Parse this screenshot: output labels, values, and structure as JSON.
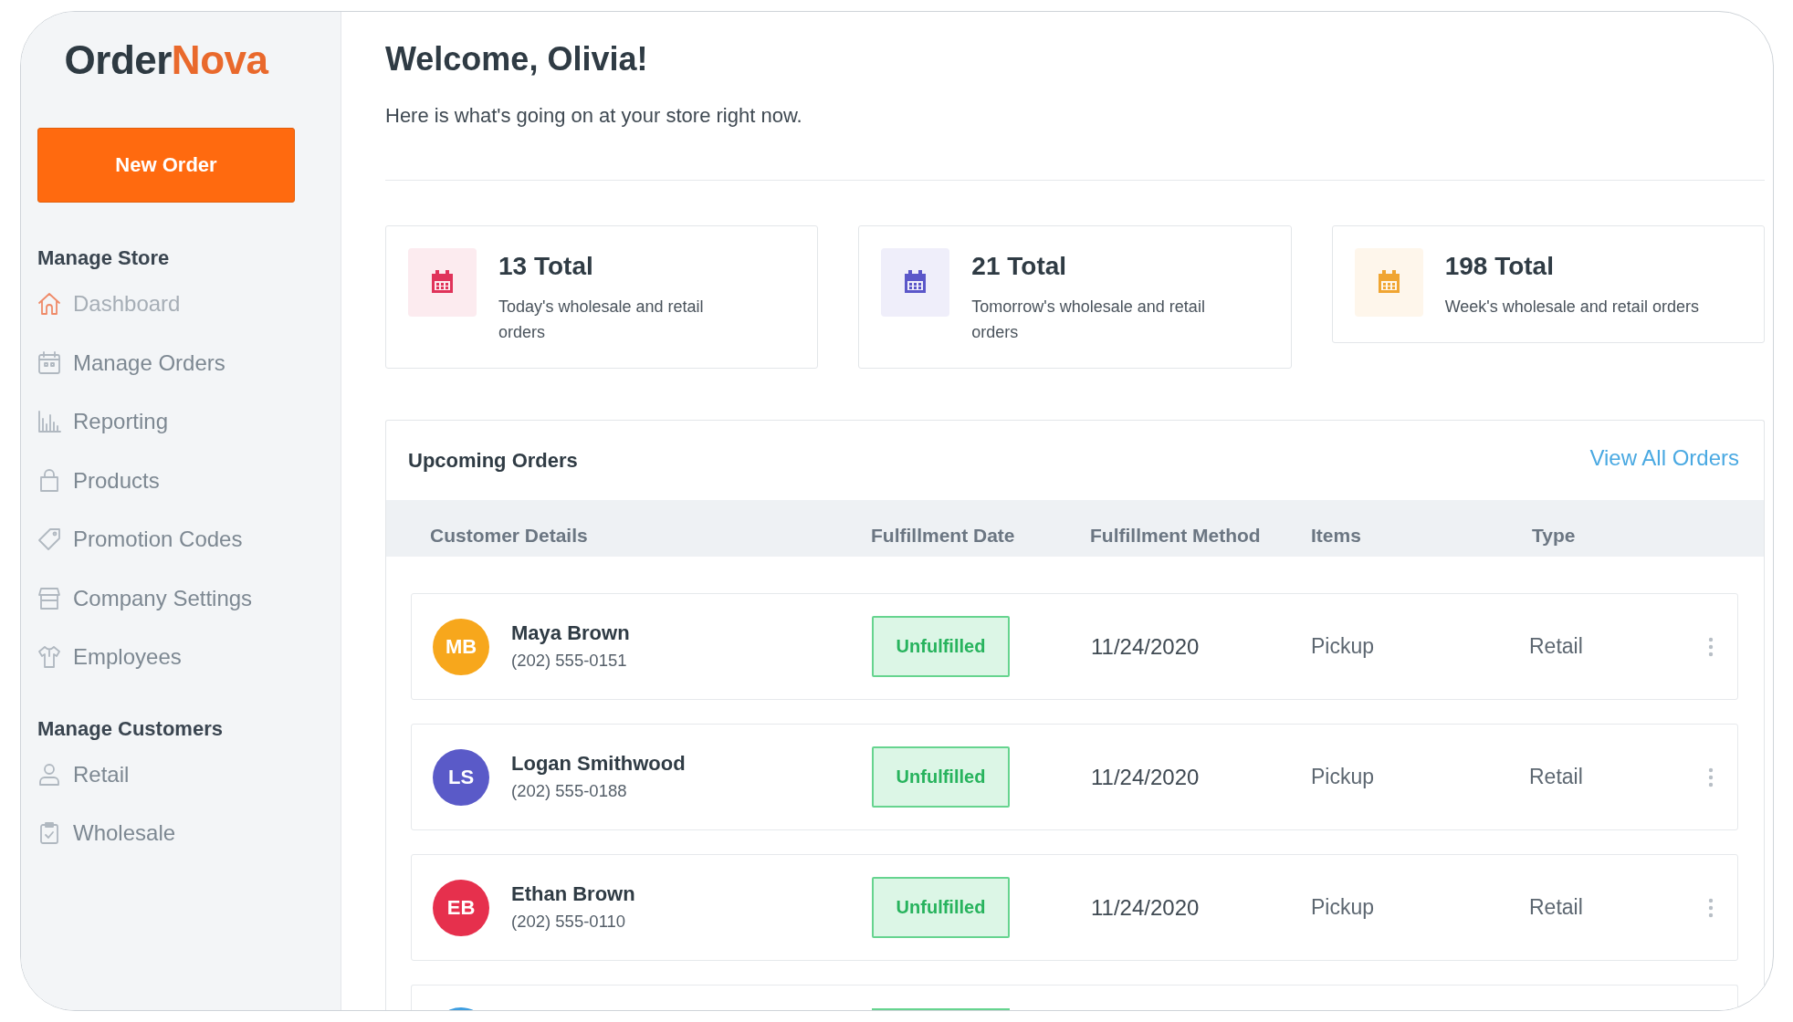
{
  "logo": {
    "primary": "Order",
    "accent": "Nova"
  },
  "sidebar": {
    "button": "New Order",
    "sections": [
      {
        "title": "Manage Store",
        "items": [
          {
            "label": "Dashboard",
            "selected": true
          },
          {
            "label": "Manage Orders",
            "selected": false
          },
          {
            "label": "Reporting",
            "selected": false
          },
          {
            "label": "Products",
            "selected": false
          },
          {
            "label": "Promotion Codes",
            "selected": false
          },
          {
            "label": "Company Settings",
            "selected": false
          },
          {
            "label": "Employees",
            "selected": false
          }
        ]
      },
      {
        "title": "Manage Customers",
        "items": [
          {
            "label": "Retail",
            "selected": false
          },
          {
            "label": "Wholesale",
            "selected": false
          }
        ]
      }
    ]
  },
  "header": {
    "title": "Welcome, Olivia!",
    "subtitle": "Here is what's going on at your store right now."
  },
  "stats": [
    {
      "total": "13 Total",
      "description": "Today's wholesale and retail orders",
      "color": "#e0335a"
    },
    {
      "total": "21 Total",
      "description": "Tomorrow's wholesale and retail orders",
      "color": "#5b57c9"
    },
    {
      "total": "198 Total",
      "description": "Week's wholesale and retail orders",
      "color": "#f0a532"
    }
  ],
  "orders": {
    "title": "Upcoming Orders",
    "link": "View All Orders",
    "columns": [
      "Customer Details",
      "Fulfillment Date",
      "Fulfillment Method",
      "Items",
      "Type"
    ],
    "rows": [
      {
        "kind": "order",
        "initials": "MB",
        "name": "Maya Brown",
        "phone": "(202) 555-0151",
        "status": "Unfulfilled",
        "date": "11/24/2020",
        "method": "Pickup",
        "type": "Retail",
        "color": "#f7a71c"
      },
      {
        "kind": "order",
        "initials": "LS",
        "name": "Logan Smithwood",
        "phone": "(202) 555-0188",
        "status": "Unfulfilled",
        "date": "11/24/2020",
        "method": "Pickup",
        "type": "Retail",
        "color": "#5a5ac8"
      },
      {
        "kind": "order",
        "initials": "EB",
        "name": "Ethan Brown",
        "phone": "(202) 555-0110",
        "status": "Unfulfilled",
        "date": "11/24/2020",
        "method": "Pickup",
        "type": "Retail",
        "color": "#e6304d"
      },
      {
        "kind": "cut-off",
        "color": "#3d9de0"
      }
    ]
  }
}
